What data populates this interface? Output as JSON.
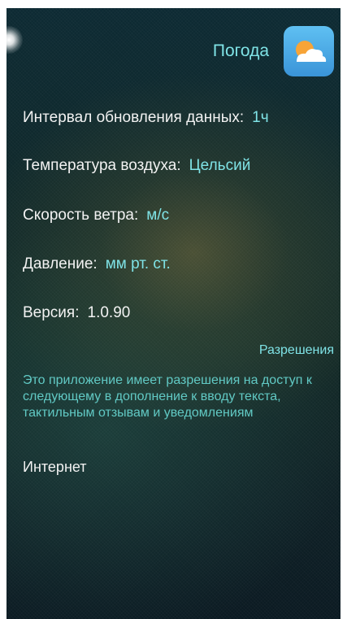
{
  "header": {
    "title": "Погода",
    "icon": "weather-partly-cloudy-icon"
  },
  "settings": {
    "update_interval": {
      "label": "Интервал обновления данных:",
      "value": "1ч"
    },
    "temperature": {
      "label": "Температура воздуха:",
      "value": "Цельсий"
    },
    "wind_speed": {
      "label": "Скорость ветра:",
      "value": "м/с"
    },
    "pressure": {
      "label": "Давление:",
      "value": "мм рт. ст."
    },
    "version": {
      "label": "Версия:",
      "value": "1.0.90"
    }
  },
  "permissions": {
    "link_label": "Разрешения",
    "description": "Это приложение имеет разрешения на доступ к следующему в дополнение к вводу текста, тактильным отзывам и уведомлениям",
    "items": [
      "Интернет"
    ]
  },
  "colors": {
    "accent": "#7fe3e6",
    "accent_secondary": "#61c9c4",
    "text": "#f2f2f2",
    "background": "#10292b",
    "icon_sky": "#4aa8e6",
    "icon_sun": "#f7a437"
  }
}
